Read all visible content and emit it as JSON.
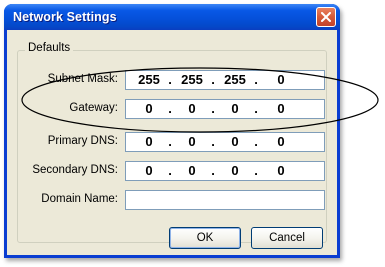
{
  "window": {
    "title": "Network Settings",
    "close_icon": "close-icon"
  },
  "group": {
    "label": "Defaults"
  },
  "fields": [
    {
      "label": "Subnet Mask:",
      "octets": [
        "255",
        "255",
        "255",
        "0"
      ]
    },
    {
      "label": "Gateway:",
      "octets": [
        "0",
        "0",
        "0",
        "0"
      ]
    },
    {
      "label": "Primary DNS:",
      "octets": [
        "0",
        "0",
        "0",
        "0"
      ]
    },
    {
      "label": "Secondary DNS:",
      "octets": [
        "0",
        "0",
        "0",
        "0"
      ]
    }
  ],
  "domain": {
    "label": "Domain Name:",
    "value": ""
  },
  "buttons": {
    "ok": "OK",
    "cancel": "Cancel"
  },
  "colors": {
    "titlebar": "#0550da",
    "face": "#ece9d8",
    "input_border": "#7f9db9",
    "close": "#d65a38"
  }
}
